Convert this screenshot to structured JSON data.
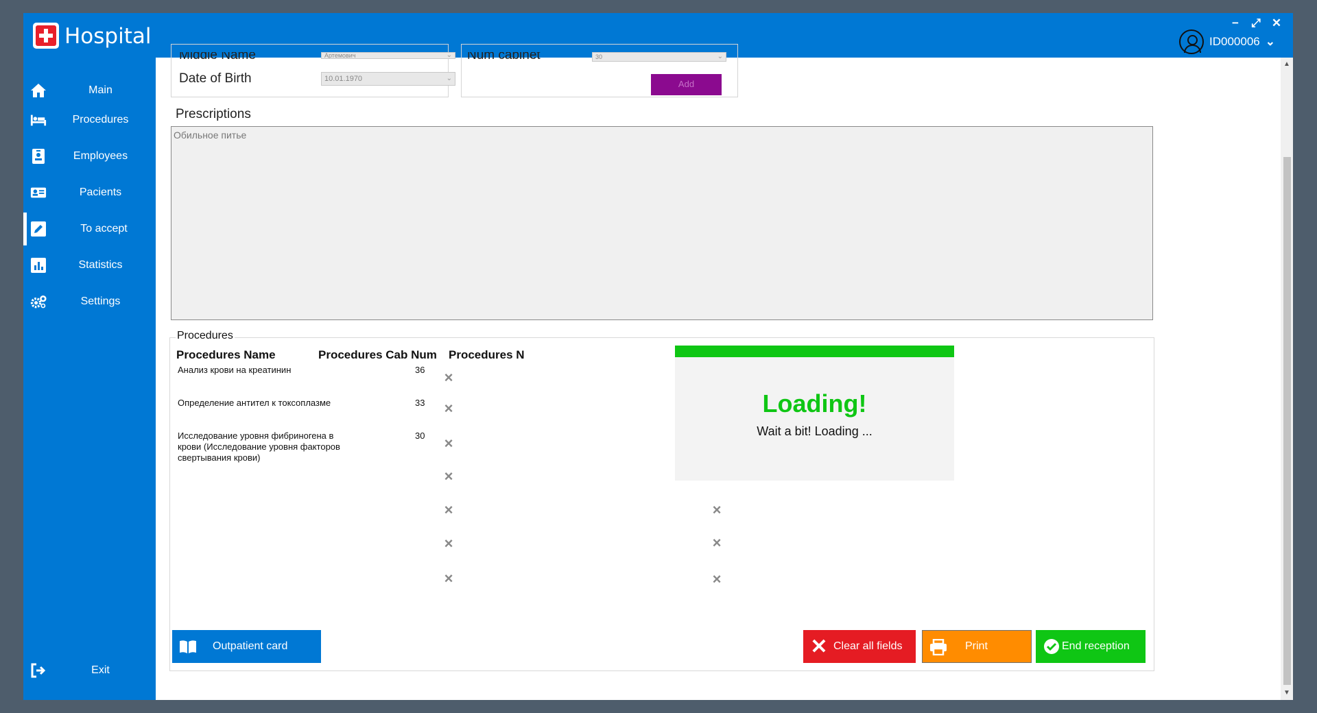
{
  "app": {
    "title": "Hospital",
    "window_controls": {
      "minimize": "−",
      "maximize": "⤢",
      "close": "✕"
    },
    "user_id": "ID000006"
  },
  "sidebar": {
    "items": [
      {
        "label": "Main",
        "icon": "home-icon"
      },
      {
        "label": "Procedures",
        "icon": "bed-icon"
      },
      {
        "label": "Employees",
        "icon": "badge-icon"
      },
      {
        "label": "Pacients",
        "icon": "id-card-icon"
      },
      {
        "label": "To accept",
        "icon": "edit-icon",
        "active": true
      },
      {
        "label": "Statistics",
        "icon": "chart-icon"
      },
      {
        "label": "Settings",
        "icon": "gears-icon"
      }
    ],
    "exit_label": "Exit"
  },
  "form": {
    "middle_name_label": "Middle Name",
    "middle_name_value": "Артемович",
    "dob_label": "Date of Birth",
    "dob_value": "10.01.1970",
    "num_cabinet_label": "Num cabinet",
    "num_cabinet_value": "30",
    "add_label": "Add"
  },
  "prescriptions": {
    "label": "Prescriptions",
    "text": "Обильное питье"
  },
  "procedures": {
    "group_label": "Procedures",
    "columns": [
      "Procedures Name",
      "Procedures Cab Num",
      "Procedures N"
    ],
    "rows": [
      {
        "name": "Анализ крови на креатинин",
        "cab": "36"
      },
      {
        "name": "Определение антител к токсоплазме",
        "cab": "33"
      },
      {
        "name": "Исследование уровня фибриногена в крови (Исследование уровня факторов свертывания крови)",
        "cab": "30"
      }
    ]
  },
  "buttons": {
    "outpatient_card": "Outpatient card",
    "clear_all": "Clear all fields",
    "print": "Print",
    "end_reception": "End reception"
  },
  "loading": {
    "title": "Loading!",
    "message": "Wait a bit! Loading ..."
  },
  "colors": {
    "primary": "#0078d4",
    "loading_green": "#0fc614",
    "clear_red": "#e51c23",
    "print_orange": "#ff8c00",
    "end_green": "#0fc614",
    "add_purple": "#8b0a8f"
  }
}
